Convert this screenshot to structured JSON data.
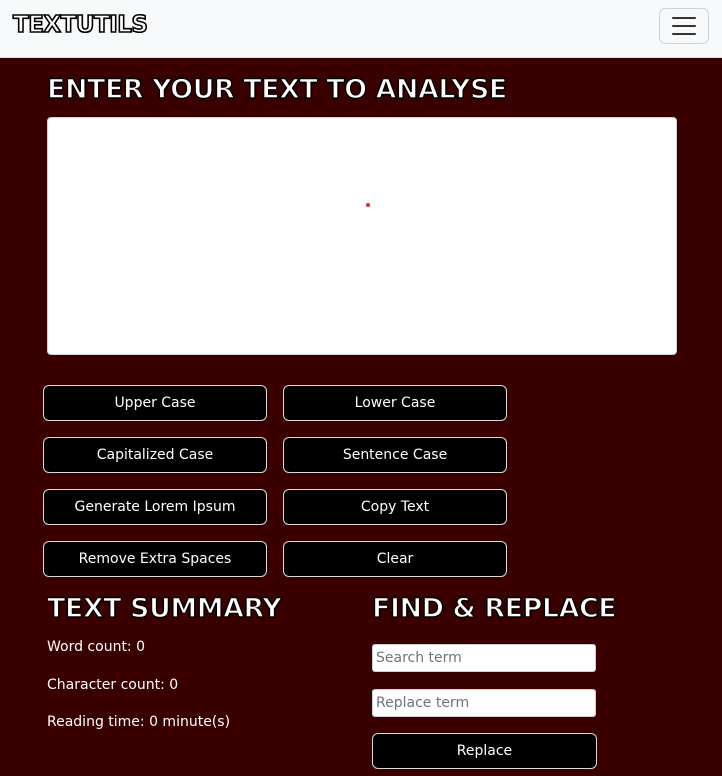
{
  "navbar": {
    "brand": "TEXTUTILS",
    "menu_icon": "hamburger-menu-icon"
  },
  "editor": {
    "heading": "ENTER YOUR TEXT TO ANALYSE",
    "value": ""
  },
  "actions": {
    "upper": "Upper Case",
    "lower": "Lower Case",
    "capitalized": "Capitalized Case",
    "sentence": "Sentence Case",
    "lorem": "Generate Lorem Ipsum",
    "copy": "Copy Text",
    "remove_spaces": "Remove Extra Spaces",
    "clear": "Clear"
  },
  "summary": {
    "heading": "TEXT SUMMARY",
    "word_count_label": "Word count:",
    "word_count": "0",
    "char_count_label": "Character count:",
    "char_count": "0",
    "reading_time_label": "Reading time:",
    "reading_time": "0 minute(s)"
  },
  "find_replace": {
    "heading": "FIND & REPLACE",
    "search_placeholder": "Search term",
    "replace_placeholder": "Replace term",
    "button": "Replace"
  },
  "colors": {
    "background": "#3a0000",
    "navbar": "#f8f9fa",
    "button_bg": "#000000",
    "button_text": "#ffffff"
  }
}
